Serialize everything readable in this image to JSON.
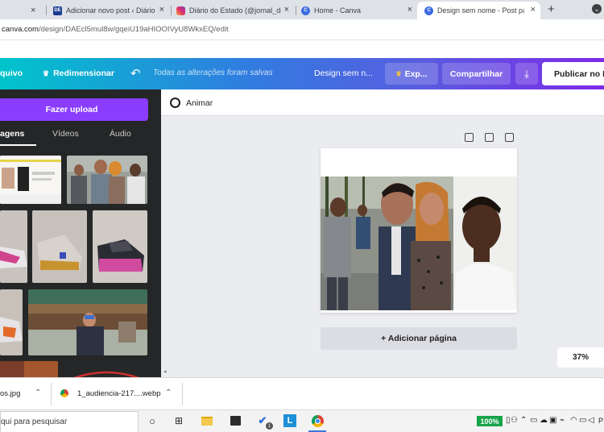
{
  "browser": {
    "tabs": [
      {
        "title": "Adicionar novo post ‹ Diário do Estado",
        "favicon": "DE"
      },
      {
        "title": "Diário do Estado (@jornal_diario)",
        "favicon": "instagram"
      },
      {
        "title": "Home - Canva",
        "favicon": "C"
      },
      {
        "title": "Design sem nome - Post para Facebook",
        "favicon": "C",
        "active": true
      }
    ],
    "close_glyph": "×",
    "new_tab_glyph": "+",
    "url_domain": "canva.com",
    "url_path": "/design/DAEcl5mul8w/gqeiU19aHIOOIVyU8WkxEQ/edit"
  },
  "header": {
    "file_menu": "quivo",
    "resize": "Redimensionar",
    "save_status": "Todas as alterações foram salvas",
    "design_name": "Design sem n...",
    "export": "Exp...",
    "share": "Compartilhar",
    "publish": "Publicar no Facebook"
  },
  "left_panel": {
    "upload": "Fazer upload",
    "tabs": [
      "agens",
      "Vídeos",
      "Áudio"
    ],
    "active_tab": 0
  },
  "editor": {
    "animate": "Animar",
    "add_page": "+ Adicionar página",
    "zoom": "37%"
  },
  "downloads": [
    {
      "name": "os.jpg"
    },
    {
      "name": "1_audiencia-217....webp"
    }
  ],
  "taskbar": {
    "search_placeholder": "qui para pesquisar",
    "battery": "100%",
    "lang": "P"
  },
  "colors": {
    "header_gradient_start": "#00c4cc",
    "header_gradient_end": "#7d2ae8",
    "upload_button": "#8b3dff",
    "panel_bg": "#252627",
    "canvas_bg": "#ebecf0"
  }
}
